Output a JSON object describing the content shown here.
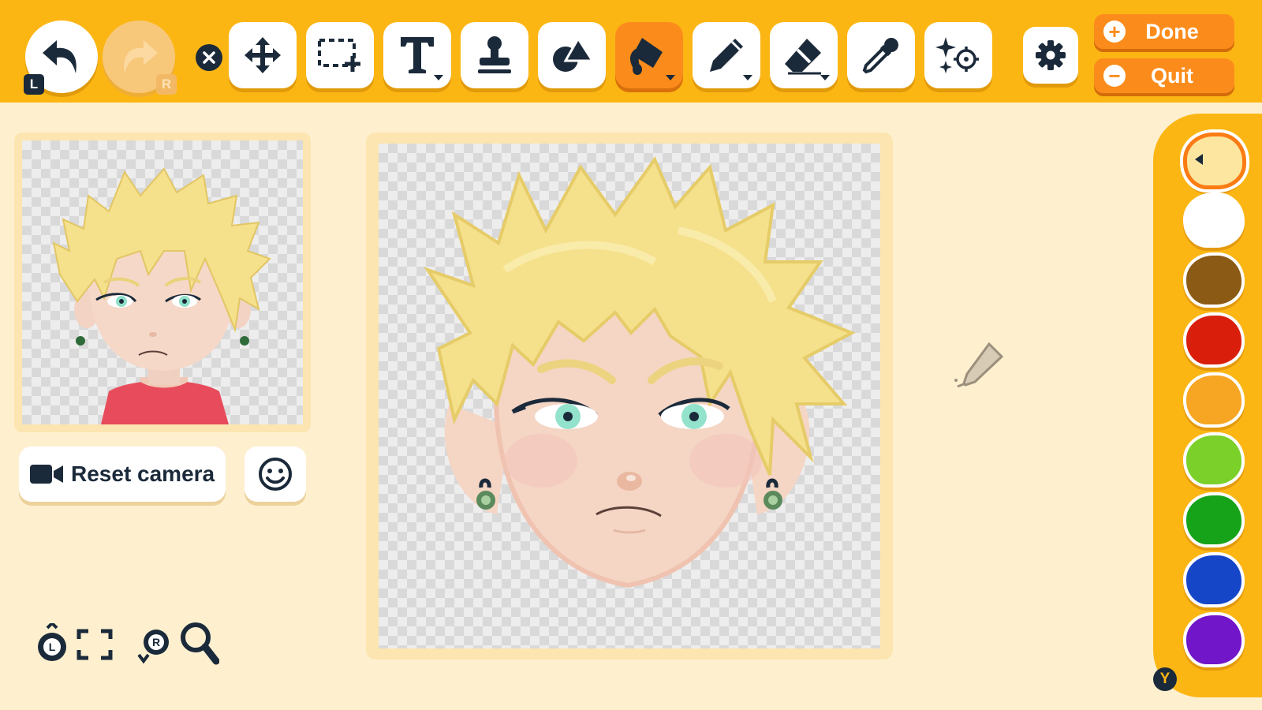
{
  "toolbar": {
    "undo_key": "L",
    "redo_key": "R",
    "tools": [
      {
        "name": "move-tool",
        "icon": "move-arrows-icon"
      },
      {
        "name": "select-tool",
        "icon": "selection-marquee-icon"
      },
      {
        "name": "text-tool",
        "icon": "text-T-icon"
      },
      {
        "name": "stamp-tool",
        "icon": "stamp-icon"
      },
      {
        "name": "shape-tool",
        "icon": "shapes-icon"
      },
      {
        "name": "fill-tool",
        "icon": "paint-bucket-icon",
        "active": true
      },
      {
        "name": "pen-tool",
        "icon": "pen-icon"
      },
      {
        "name": "eraser-tool",
        "icon": "eraser-icon"
      },
      {
        "name": "eyedropper-tool",
        "icon": "eyedropper-icon"
      },
      {
        "name": "effects-tool",
        "icon": "sparkle-target-icon"
      }
    ],
    "done_label": "Done",
    "done_symbol": "+",
    "quit_label": "Quit",
    "quit_symbol": "−"
  },
  "preview": {
    "reset_camera_label": "Reset camera"
  },
  "palette": {
    "colors": [
      "#fde7a0",
      "#ffffff",
      "#8b5a14",
      "#d91f0c",
      "#f6a623",
      "#7bd02a",
      "#16a31a",
      "#1646c8",
      "#7116c9"
    ],
    "selected_index": 0,
    "shortcut_key": "Y"
  },
  "colors": {
    "accent": "#fcb614",
    "active_tool": "#fb8c1c",
    "background": "#fef0cf",
    "hair": "#f5e28a",
    "skin": "#f5d5c4"
  }
}
